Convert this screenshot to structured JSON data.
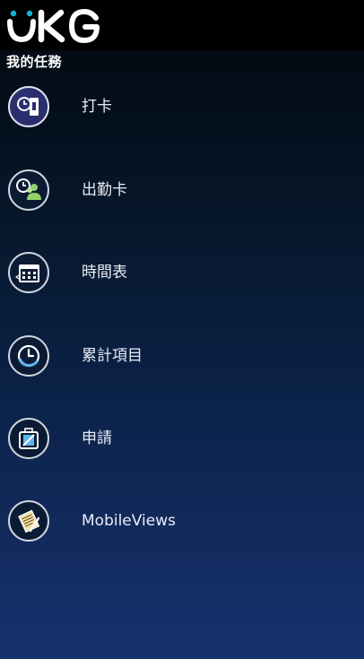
{
  "header": {
    "logo_text": "UKG",
    "brand_color": "#ffffff",
    "accent_color": "#12b3cf"
  },
  "section": {
    "title": "我的任務"
  },
  "menu": {
    "items": [
      {
        "label": "打卡",
        "icon": "punch-clock-icon"
      },
      {
        "label": "出勤卡",
        "icon": "timecard-people-icon"
      },
      {
        "label": "時間表",
        "icon": "calendar-schedule-icon"
      },
      {
        "label": "累計項目",
        "icon": "accruals-clock-icon"
      },
      {
        "label": "申請",
        "icon": "request-briefcase-icon"
      },
      {
        "label": "MobileViews",
        "icon": "mobileviews-notes-icon"
      }
    ]
  }
}
